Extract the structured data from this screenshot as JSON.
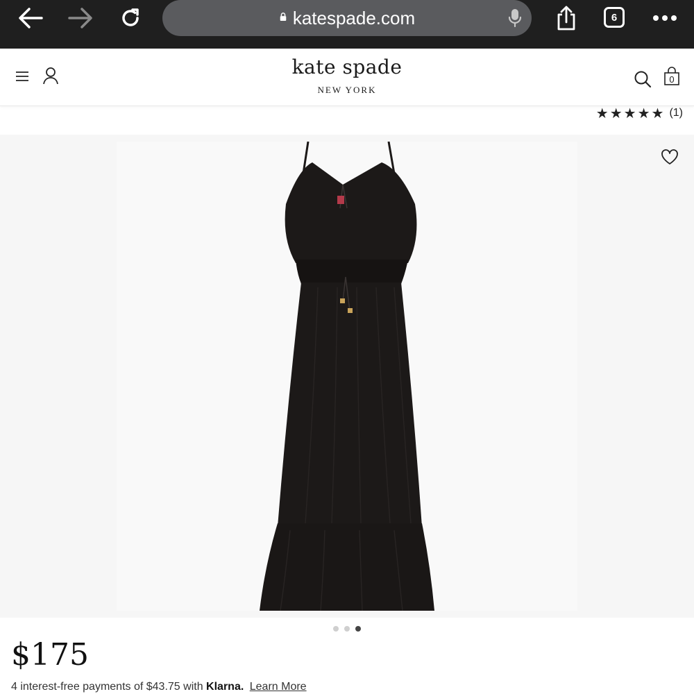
{
  "browser": {
    "url": "katespade.com",
    "tab_count": "6"
  },
  "header": {
    "brand_name": "kate spade",
    "brand_sub": "NEW YORK",
    "cart_count": "0"
  },
  "rating": {
    "stars": "★★★★★",
    "count": "(1)"
  },
  "gallery": {
    "image_count": 3,
    "active_index": 2
  },
  "product": {
    "price": "$175",
    "klarna_text": "4 interest-free payments of $43.75 with",
    "klarna_brand": "Klarna.",
    "learn_more": "Learn More"
  },
  "colors": {
    "chrome_bg": "#1f1f1f",
    "url_bar_bg": "#5a5b5e",
    "dress": "#1c1918"
  }
}
